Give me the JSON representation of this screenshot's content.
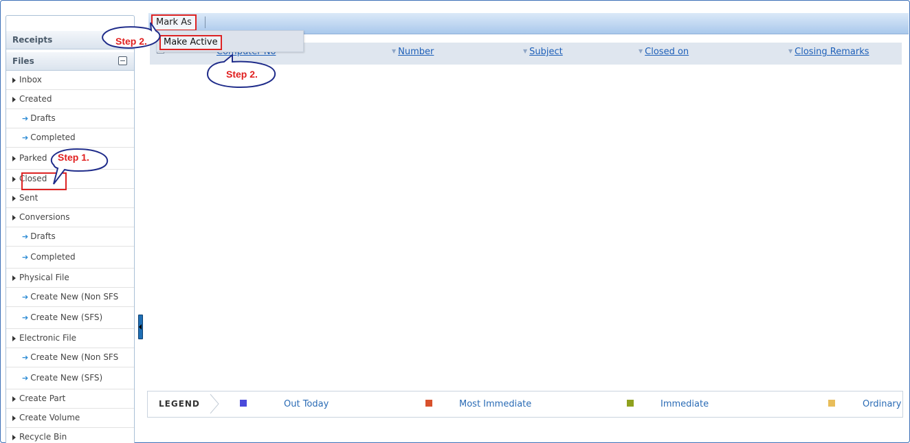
{
  "sidebar": {
    "receipts_label": "Receipts",
    "files_label": "Files",
    "items": [
      {
        "label": "Inbox",
        "type": "parent"
      },
      {
        "label": "Created",
        "type": "parent"
      },
      {
        "label": "Drafts",
        "type": "child"
      },
      {
        "label": "Completed",
        "type": "child"
      },
      {
        "label": "Parked",
        "type": "parent"
      },
      {
        "label": "Closed",
        "type": "parent"
      },
      {
        "label": "Sent",
        "type": "parent"
      },
      {
        "label": "Conversions",
        "type": "parent"
      },
      {
        "label": "Drafts",
        "type": "child"
      },
      {
        "label": "Completed",
        "type": "child"
      },
      {
        "label": "Physical File",
        "type": "parent"
      },
      {
        "label": "Create New (Non SFS",
        "type": "child"
      },
      {
        "label": "Create New (SFS)",
        "type": "child"
      },
      {
        "label": "Electronic File",
        "type": "parent"
      },
      {
        "label": "Create New (Non SFS",
        "type": "child"
      },
      {
        "label": "Create New (SFS)",
        "type": "child"
      },
      {
        "label": "Create Part",
        "type": "parent"
      },
      {
        "label": "Create Volume",
        "type": "parent"
      },
      {
        "label": "Recycle Bin",
        "type": "parent"
      }
    ]
  },
  "toolbar": {
    "mark_as_label": "Mark As"
  },
  "dropdown": {
    "make_active_label": "Make Active"
  },
  "table": {
    "columns": [
      "Computer No",
      "Number",
      "Subject",
      "Closed on",
      "Closing Remarks"
    ]
  },
  "legend": {
    "title": "LEGEND",
    "items": [
      {
        "label": "Out Today",
        "color": "#4a4adb"
      },
      {
        "label": "Most Immediate",
        "color": "#d8512c"
      },
      {
        "label": "Immediate",
        "color": "#8fa11e"
      },
      {
        "label": "Ordinary",
        "color": "#e8bd5a"
      }
    ]
  },
  "callouts": {
    "step1": "Step 1.",
    "step2_top": "Step 2.",
    "step2_bottom": "Step 2."
  },
  "colors": {
    "annotation_red": "#e01e1e",
    "link_blue": "#1d5fb8",
    "toolbar_blue": "#a9c8ec"
  }
}
